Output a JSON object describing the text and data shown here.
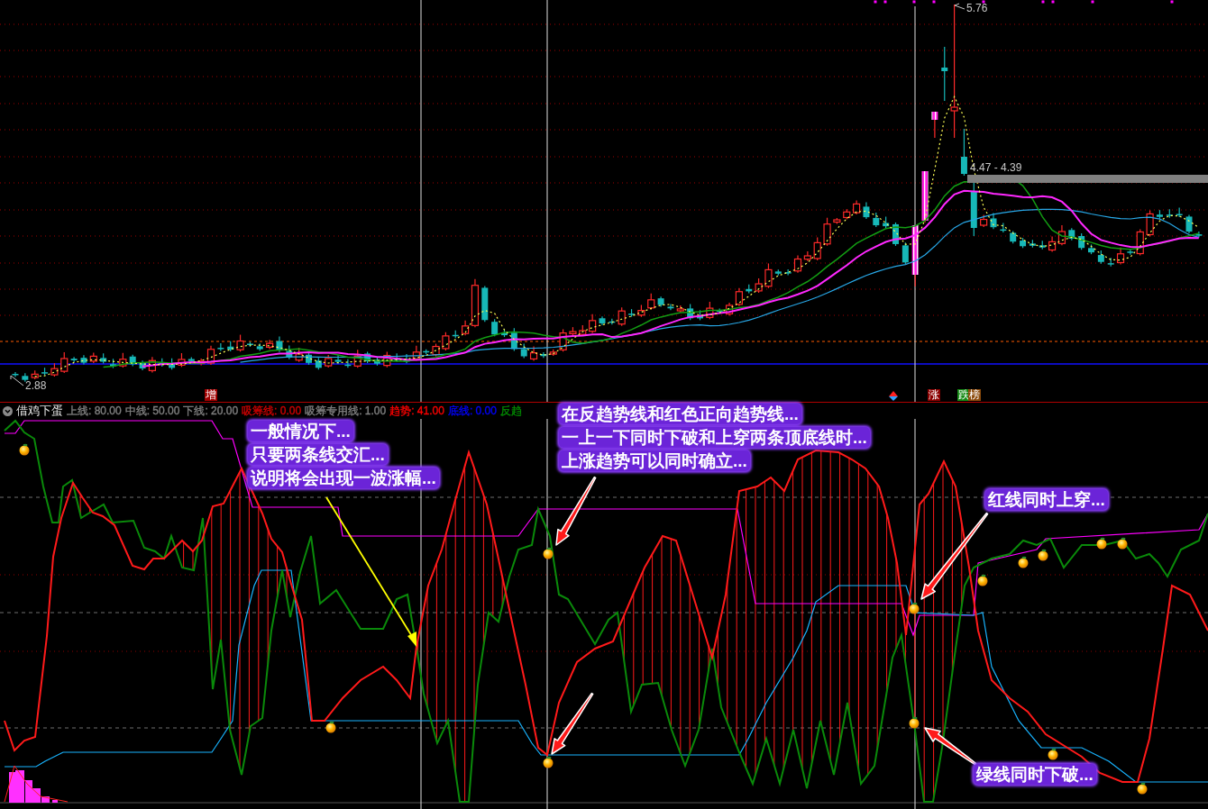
{
  "price_chart": {
    "high_label": "5.76",
    "range_label": "4.47 - 4.39",
    "low_label": "2.88",
    "markers": [
      {
        "text": "增",
        "color": "#a00000"
      },
      {
        "text": "涨",
        "color": "#8b0000"
      },
      {
        "text": "跌",
        "color": "#158a15"
      },
      {
        "text": "榜",
        "color": "#8b4a0b"
      }
    ]
  },
  "indicator": {
    "name": "借鸡下蛋",
    "values": [
      {
        "text": "上线: 80.00",
        "color": "#808080"
      },
      {
        "text": "中线: 50.00",
        "color": "#808080"
      },
      {
        "text": "下线: 20.00",
        "color": "#808080"
      },
      {
        "text": "吸筹线: 0.00",
        "color": "#d00000"
      },
      {
        "text": "吸筹专用线: 1.00",
        "color": "#808080"
      },
      {
        "text": "趋势: 41.00",
        "color": "#ff0000"
      },
      {
        "text": "底线: 0.00",
        "color": "#0000ff"
      },
      {
        "text": "反趋",
        "color": "#008a00"
      }
    ]
  },
  "annotations": [
    {
      "lines": [
        "一般情况下...",
        "只要两条线交汇...",
        "说明将会出现一波涨幅..."
      ]
    },
    {
      "lines": [
        "在反趋势线和红色正向趋势线...",
        "一上一下同时下破和上穿两条顶底线时...",
        "上涨趋势可以同时确立..."
      ]
    },
    {
      "lines": [
        "红线同时上穿..."
      ]
    },
    {
      "lines": [
        "绿线同时下破..."
      ]
    }
  ]
}
